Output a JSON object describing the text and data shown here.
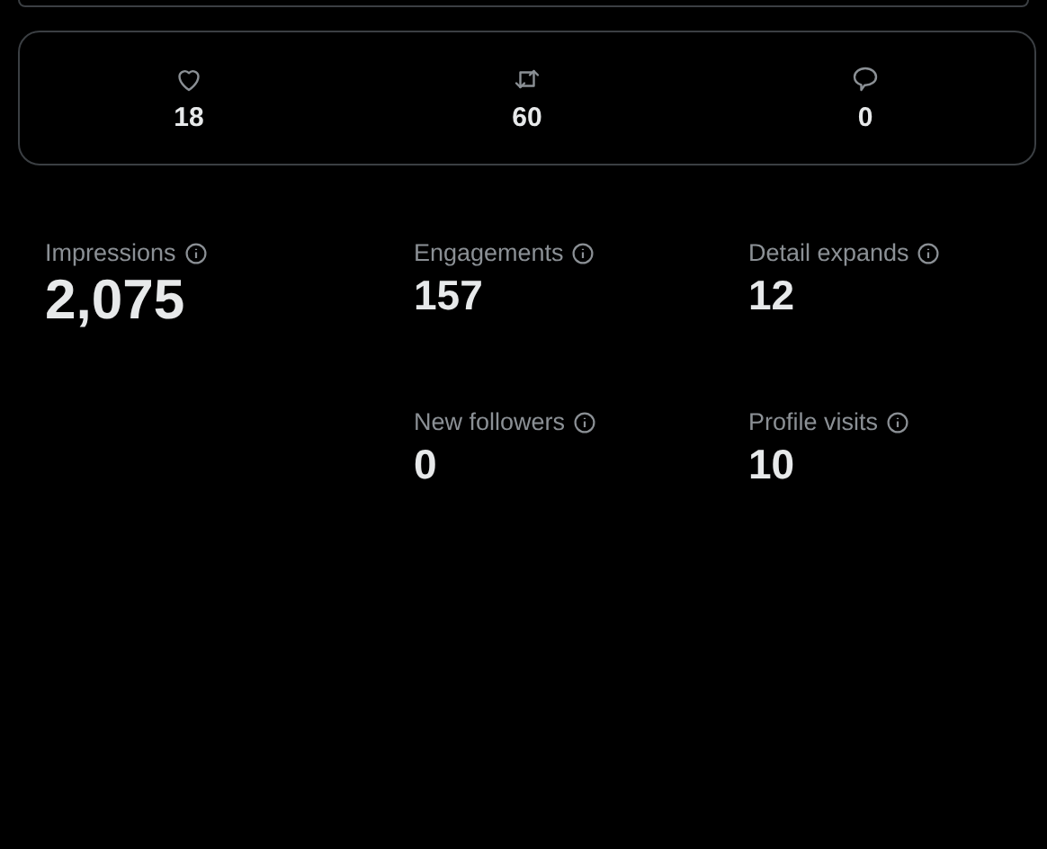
{
  "engagement_counts": [
    {
      "kind": "like",
      "count": "18"
    },
    {
      "kind": "repost",
      "count": "60"
    },
    {
      "kind": "reply",
      "count": "0"
    }
  ],
  "metrics": [
    {
      "kind": "primary",
      "label": "Impressions",
      "value": "2,075"
    },
    {
      "kind": "secondary",
      "label": "Engagements",
      "value": "157"
    },
    {
      "kind": "secondary",
      "label": "Detail expands",
      "value": "12"
    },
    {
      "kind": "secondary",
      "label": "New followers",
      "value": "0"
    },
    {
      "kind": "secondary",
      "label": "Profile visits",
      "value": "10"
    }
  ]
}
